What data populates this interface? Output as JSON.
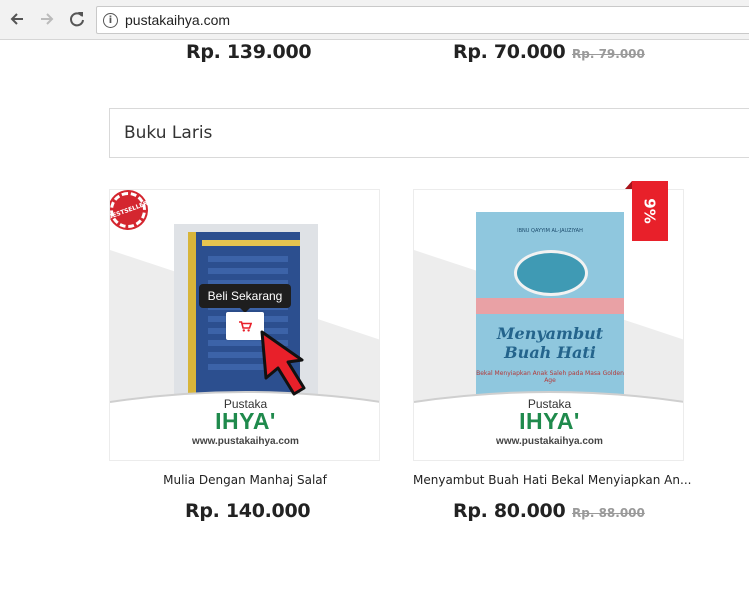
{
  "browser": {
    "url": "pustakaihya.com"
  },
  "top_row": {
    "left_price": "Rp. 139.000",
    "right_price": "Rp. 70.000",
    "right_old_price": "Rp. 79.000"
  },
  "section": {
    "title": "Buku Laris"
  },
  "products": [
    {
      "name": "Mulia Dengan Manhaj Salaf",
      "price": "Rp. 140.000",
      "publisher_small": "Pustaka",
      "publisher_big": "IHYA'",
      "publisher_url": "www.pustakaihya.com",
      "badge": "BESTSELLER",
      "tooltip": "Beli Sekarang"
    },
    {
      "name": "Menyambut Buah Hati Bekal Menyiapkan An...",
      "price": "Rp. 80.000",
      "old_price": "Rp. 88.000",
      "discount": "9%",
      "publisher_small": "Pustaka",
      "publisher_big": "IHYA'",
      "publisher_url": "www.pustakaihya.com",
      "cover_title": "Menyambut Buah Hati",
      "cover_subtitle": "Bekal Menyiapkan Anak Saleh pada Masa Golden Age",
      "cover_author": "IBNU QAYYIM AL-JAUZIYAH"
    }
  ],
  "colors": {
    "accent_red": "#e8202a",
    "publisher_green": "#1f8a4c",
    "tooltip_bg": "#1e1e1e"
  },
  "icons": [
    "back-arrow-icon",
    "forward-arrow-icon",
    "reload-icon",
    "info-icon",
    "cart-icon",
    "mouse-pointer-icon"
  ]
}
